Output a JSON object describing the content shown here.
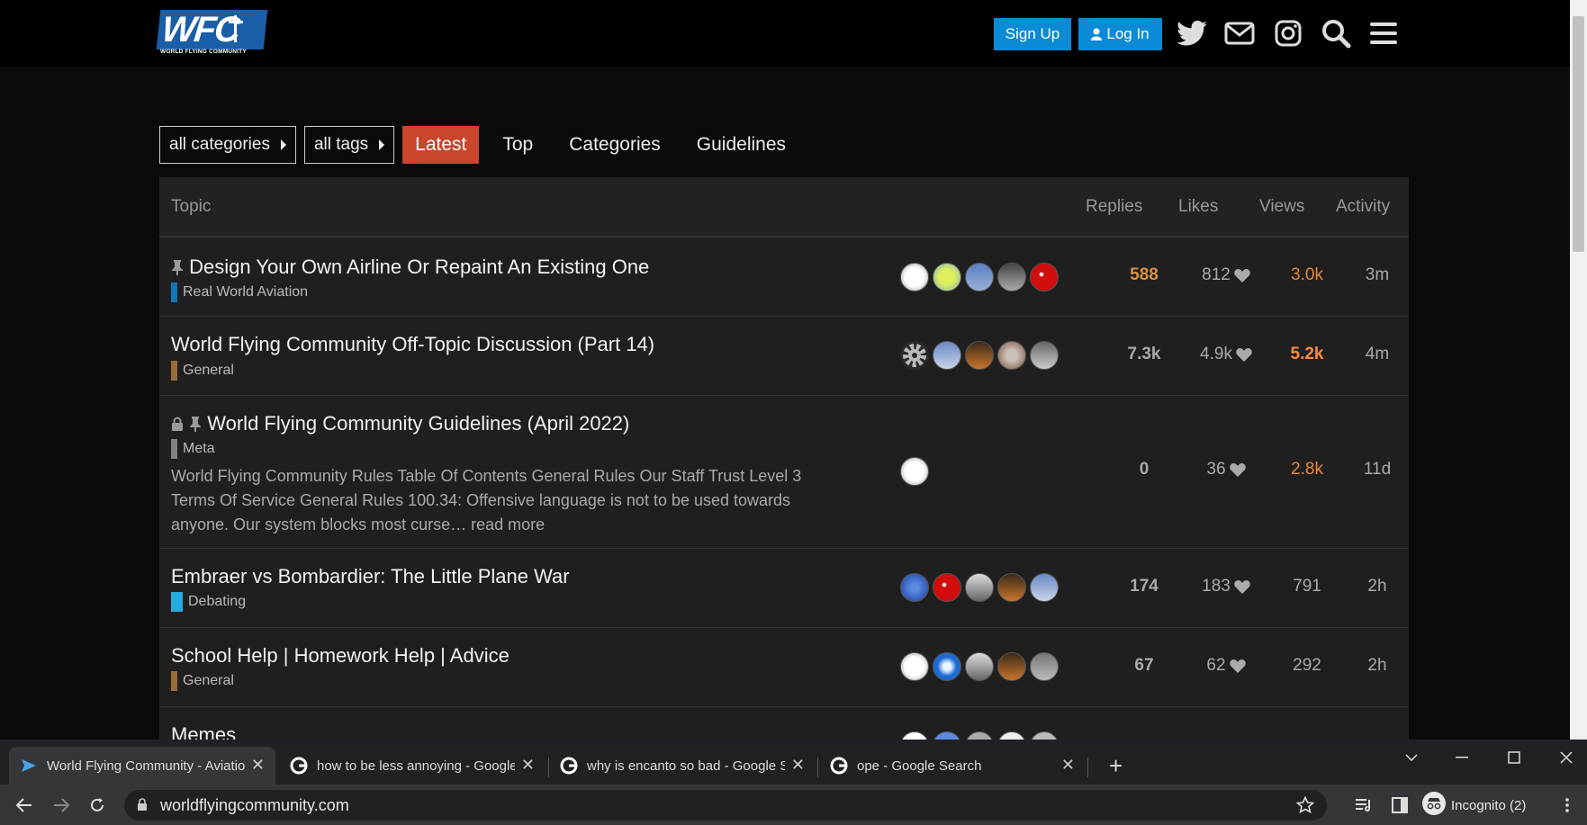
{
  "header": {
    "logo_text": "WFC",
    "logo_subtext": "WORLD FLYING COMMUNITY",
    "signup_label": "Sign Up",
    "login_label": "Log In",
    "icons": [
      "twitter-icon",
      "mail-icon",
      "instagram-icon",
      "search-icon",
      "hamburger-menu-icon"
    ]
  },
  "nav": {
    "categories_dropdown": "all categories",
    "tags_dropdown": "all tags",
    "links": [
      {
        "label": "Latest",
        "active": true
      },
      {
        "label": "Top",
        "active": false
      },
      {
        "label": "Categories",
        "active": false
      },
      {
        "label": "Guidelines",
        "active": false
      }
    ]
  },
  "table": {
    "headers": {
      "topic": "Topic",
      "replies": "Replies",
      "likes": "Likes",
      "views": "Views",
      "activity": "Activity"
    },
    "rows": [
      {
        "title": "Design Your Own Airline Or Repaint An Existing One",
        "category": "Real World Aviation",
        "category_color": "#0e76bd",
        "pinned": true,
        "locked": false,
        "replies": "588",
        "likes": "812",
        "views": "3.0k",
        "activity": "3m",
        "excerpt": ""
      },
      {
        "title": "World Flying Community Off-Topic Discussion (Part 14)",
        "category": "General",
        "category_color": "#9b6b35",
        "pinned": false,
        "locked": false,
        "replies": "7.3k",
        "likes": "4.9k",
        "views": "5.2k",
        "activity": "4m",
        "excerpt": ""
      },
      {
        "title": "World Flying Community Guidelines (April 2022)",
        "category": "Meta",
        "category_color": "#808281",
        "pinned": true,
        "locked": true,
        "replies": "0",
        "likes": "36",
        "views": "2.8k",
        "activity": "11d",
        "excerpt": "World Flying Community Rules Table Of Contents General Rules Our Staff Trust Level 3 Terms Of Service General Rules 100.34: Offensive language is not to be used towards anyone. Our system blocks most curse…",
        "read_more": "read more"
      },
      {
        "title": "Embraer vs Bombardier: The Little Plane War",
        "category": "Debating",
        "category_color": "#25aae1",
        "pinned": false,
        "locked": false,
        "replies": "174",
        "likes": "183",
        "views": "791",
        "activity": "2h",
        "excerpt": ""
      },
      {
        "title": "School Help | Homework Help | Advice",
        "category": "General",
        "category_color": "#9b6b35",
        "pinned": false,
        "locked": false,
        "replies": "67",
        "likes": "62",
        "views": "292",
        "activity": "2h",
        "excerpt": ""
      },
      {
        "title": "Memes",
        "category": "",
        "category_color": "#9b6b35",
        "pinned": false,
        "locked": false,
        "replies": "",
        "likes": "",
        "views": "",
        "activity": "",
        "excerpt": ""
      }
    ]
  },
  "browser": {
    "tabs": [
      {
        "label": "World Flying Community - Aviatio",
        "active": true
      },
      {
        "label": "how to be less annoying - Google",
        "active": false
      },
      {
        "label": "why is encanto so bad - Google S",
        "active": false
      },
      {
        "label": "ope - Google Search",
        "active": false
      }
    ],
    "new_tab": "+",
    "url": "worldflyingcommunity.com",
    "incognito_label": "Incognito (2)"
  }
}
